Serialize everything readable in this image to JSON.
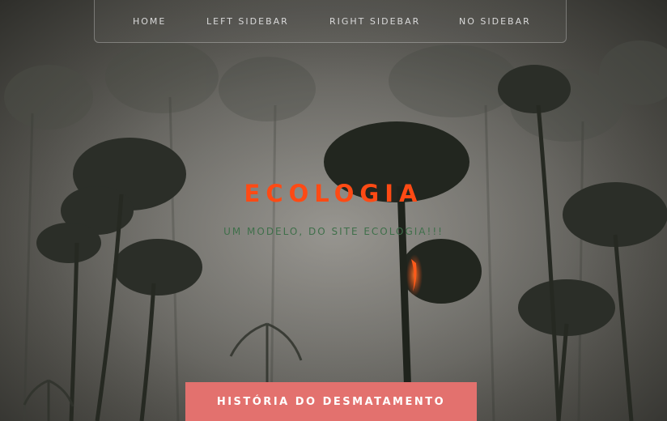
{
  "nav": {
    "items": [
      {
        "label": "HOME"
      },
      {
        "label": "LEFT SIDEBAR"
      },
      {
        "label": "RIGHT SIDEBAR"
      },
      {
        "label": "NO SIDEBAR"
      }
    ]
  },
  "hero": {
    "title": "ECOLOGIA",
    "subtitle": "UM MODELO, DO SITE ECOLOGIA!!!",
    "cta_label": "HISTÓRIA DO DESMATAMENTO"
  },
  "colors": {
    "title": "#ff4a14",
    "subtitle": "#3f6f4a",
    "cta_background": "#e3716e",
    "nav_text": "#d9d9d9"
  },
  "background": {
    "description_icon": "smoky-forest-fire-image"
  }
}
